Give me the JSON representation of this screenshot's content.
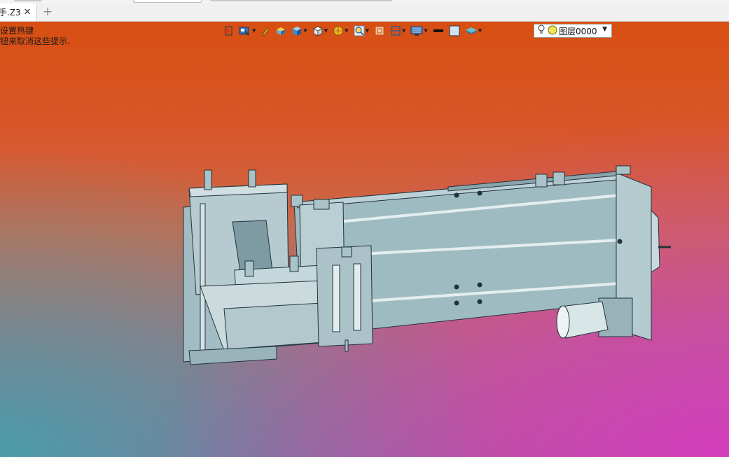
{
  "tab": {
    "label": "手.Z3",
    "close": "✕",
    "add": "+"
  },
  "hint": {
    "line1": "设置热键",
    "line2": "钮来取消这些提示."
  },
  "toolbar": {
    "icons": [
      "exit-sketch-icon",
      "view-filter-icon",
      "pen-icon",
      "solid-block-icon",
      "cube-blue-icon",
      "cube-wire-icon",
      "render-ball-icon",
      "zoom-icon",
      "frame-icon",
      "section-icon",
      "display-icon",
      "black-line-icon",
      "color-swatch-icon",
      "layers-stack-icon"
    ]
  },
  "layer": {
    "value": "图层0000"
  },
  "colors": {
    "part": "#a9c3c9",
    "edge": "#2b3a3e",
    "bg_top": "#d84f12",
    "bg_bottom_right": "#d63cbe",
    "bg_bottom_left": "#46a0aa"
  }
}
